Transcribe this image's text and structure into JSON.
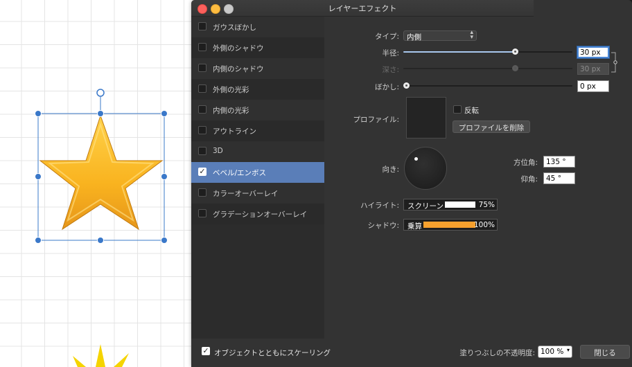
{
  "dialog": {
    "title": "レイヤーエフェクト"
  },
  "effects": [
    {
      "label": "ガウスぼかし",
      "checked": false
    },
    {
      "label": "外側のシャドウ",
      "checked": false
    },
    {
      "label": "内側のシャドウ",
      "checked": false
    },
    {
      "label": "外側の光彩",
      "checked": false
    },
    {
      "label": "内側の光彩",
      "checked": false
    },
    {
      "label": "アウトライン",
      "checked": false
    },
    {
      "label": "3D",
      "checked": false
    },
    {
      "label": "ベベル/エンボス",
      "checked": true,
      "selected": true
    },
    {
      "label": "カラーオーバーレイ",
      "checked": false
    },
    {
      "label": "グラデーションオーバーレイ",
      "checked": false
    }
  ],
  "params": {
    "type_label": "タイプ:",
    "type_value": "内側",
    "radius_label": "半径:",
    "radius_value": "30 px",
    "radius_fraction": 0.66,
    "depth_label": "深さ:",
    "depth_value": "30 px",
    "depth_fraction": 0.66,
    "blur_label": "ぼかし:",
    "blur_value": "0 px",
    "blur_fraction": 0.0,
    "profile_label": "プロファイル:",
    "invert_label": "反転",
    "remove_profile_label": "プロファイルを削除",
    "direction_label": "向き:",
    "azimuth_label": "方位角:",
    "azimuth_value": "135 °",
    "elevation_label": "仰角:",
    "elevation_value": "45 °",
    "highlight_label": "ハイライト:",
    "highlight_mode": "スクリーン",
    "highlight_color": "#ffffff",
    "highlight_opacity": "75%",
    "shadow_label": "シャドウ:",
    "shadow_mode": "乗算",
    "shadow_color": "#f7a12e",
    "shadow_opacity": "100%"
  },
  "footer": {
    "scale_label": "オブジェクトとともにスケーリング",
    "scale_checked": true,
    "fill_opacity_label": "塗りつぶしの不透明度:",
    "fill_opacity_value": "100 %",
    "close_label": "閉じる"
  },
  "colors": {
    "star_fill": "#f9b31f",
    "selection": "#3a78c9",
    "accent": "#5a7eb8"
  }
}
